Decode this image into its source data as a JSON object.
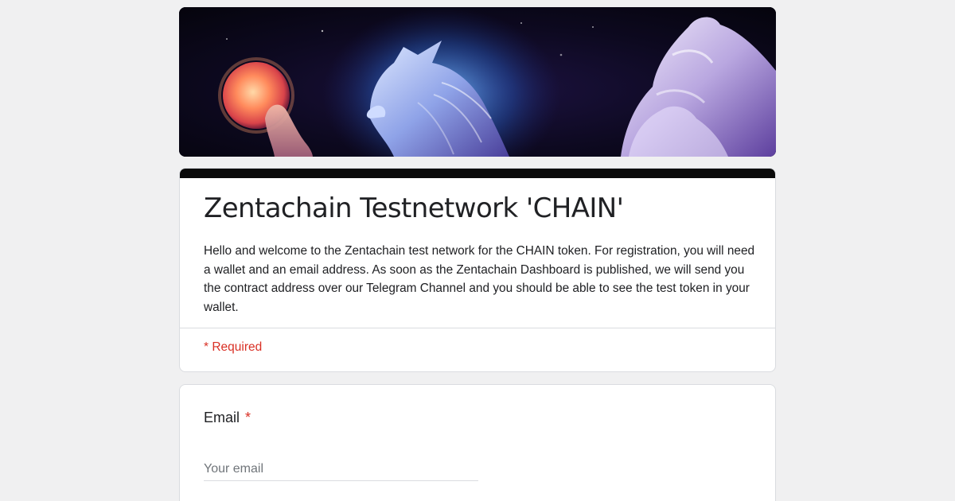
{
  "banner": {
    "image_name": "fantasy-wolf-moon-banner",
    "colors": {
      "sky": "#0a0716",
      "glow_blue": "#3d8cff",
      "moon": "#ff7a55",
      "accent_purple": "#6a3fb5"
    }
  },
  "form": {
    "title": "Zentachain Testnetwork 'CHAIN'",
    "description": "Hello and welcome to the Zentachain test network for the CHAIN token. For registration, you will need a wallet and an email address. As soon as the Zentachain Dashboard is published, we will send you the contract address over our Telegram Channel and you should be able to see the test token in your wallet.",
    "required_note": "* Required",
    "accent_color": "#0a0a0a",
    "required_color": "#d93025"
  },
  "question": {
    "label": "Email",
    "required_mark": "*",
    "placeholder": "Your email",
    "value": ""
  }
}
